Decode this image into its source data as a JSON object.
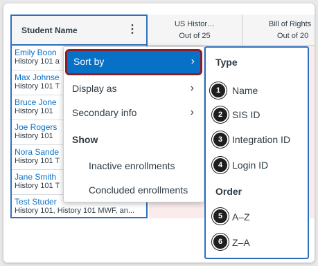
{
  "header": {
    "student_col_label": "Student Name",
    "kebab_glyph": "⋮",
    "assignments": [
      {
        "title": "US Histor…",
        "points": "Out of 25"
      },
      {
        "title": "Bill of Rights",
        "points": "Out of 20"
      }
    ]
  },
  "students": [
    {
      "name": "Emily Boon",
      "section": "History 101 a"
    },
    {
      "name": "Max Johnse",
      "section": "History 101 T"
    },
    {
      "name": "Bruce Jone",
      "section": "History 101"
    },
    {
      "name": "Joe Rogers",
      "section": "History 101"
    },
    {
      "name": "Nora Sande",
      "section": "History 101 T"
    },
    {
      "name": "Jane Smith",
      "section": "History 101 T"
    },
    {
      "name": "Test Studer",
      "section": "History 101, History 101 MWF, an..."
    }
  ],
  "menu": {
    "sort_by": "Sort by",
    "display_as": "Display as",
    "secondary_info": "Secondary info",
    "show_heading": "Show",
    "inactive": "Inactive enrollments",
    "concluded": "Concluded enrollments",
    "chevron": "›"
  },
  "submenu": {
    "type_heading": "Type",
    "order_heading": "Order",
    "items": [
      {
        "n": "1",
        "label": "Name"
      },
      {
        "n": "2",
        "label": "SIS ID"
      },
      {
        "n": "3",
        "label": "Integration ID"
      },
      {
        "n": "4",
        "label": "Login ID"
      },
      {
        "n": "5",
        "label": "A–Z"
      },
      {
        "n": "6",
        "label": "Z–A"
      }
    ]
  },
  "colors": {
    "accent": "#0770c7",
    "highlight_border": "#8b1d27",
    "focus_border": "#2d6fbf",
    "grade_cell_bg": "#fbecec"
  },
  "icons": [
    "kebab-menu-icon",
    "chevron-right-icon"
  ]
}
